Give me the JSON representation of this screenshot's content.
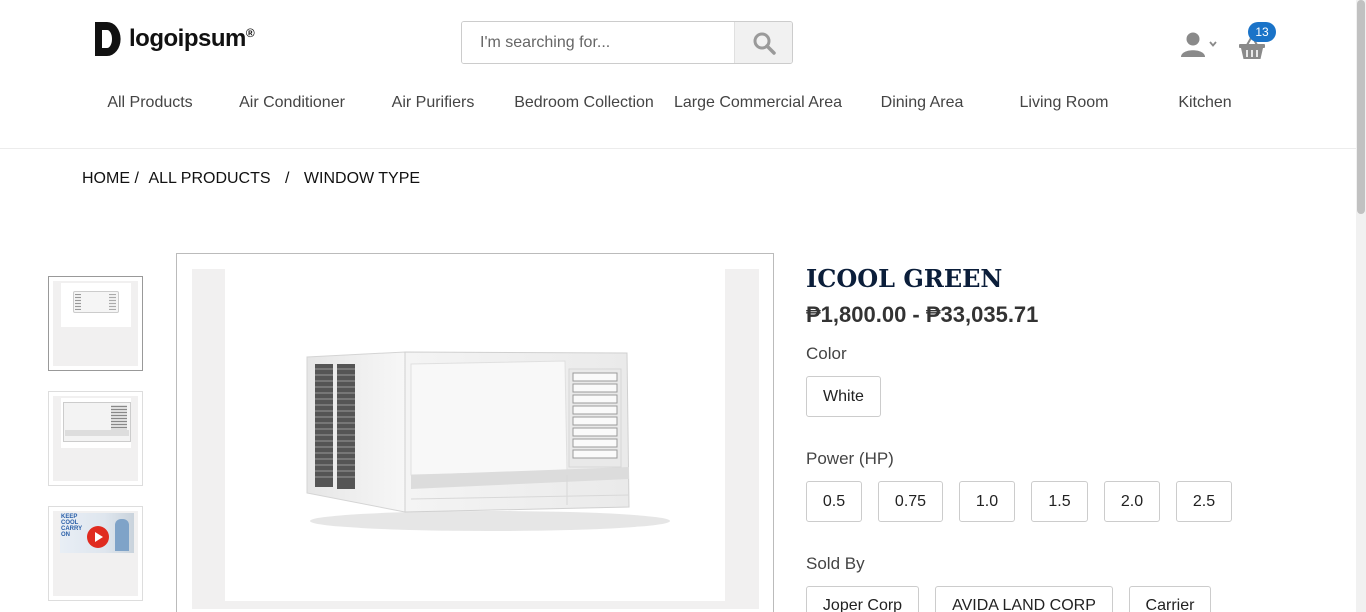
{
  "header": {
    "logo_text": "logoipsum",
    "logo_mark": "®",
    "search_placeholder": "I'm searching for...",
    "search_icon": "search-icon",
    "user_icon": "user-icon",
    "cart_icon": "basket-icon",
    "cart_count": "13"
  },
  "nav": {
    "items": [
      "All Products",
      "Air Conditioner",
      "Air Purifiers",
      "Bedroom Collection",
      "Large Commercial Area",
      "Dining Area",
      "Living Room",
      "Kitchen"
    ]
  },
  "breadcrumb": {
    "home": "HOME /",
    "all_products": "ALL PRODUCTS",
    "sep": "/",
    "current": "WINDOW TYPE"
  },
  "product": {
    "title": "ICOOL GREEN",
    "price": "₱1,800.00 - ₱33,035.71",
    "color_label": "Color",
    "colors": [
      "White"
    ],
    "power_label": "Power (HP)",
    "powers": [
      "0.5",
      "0.75",
      "1.0",
      "1.5",
      "2.0",
      "2.5"
    ],
    "sold_by_label": "Sold By",
    "sellers": [
      "Joper Corp",
      "AVIDA LAND CORP",
      "Carrier"
    ],
    "video_thumb_text": "KEEP COOL CARRY ON"
  },
  "colors": {
    "badge": "#1a73c8",
    "title": "#0b1e3a",
    "icon_gray": "#8a8a8a"
  }
}
